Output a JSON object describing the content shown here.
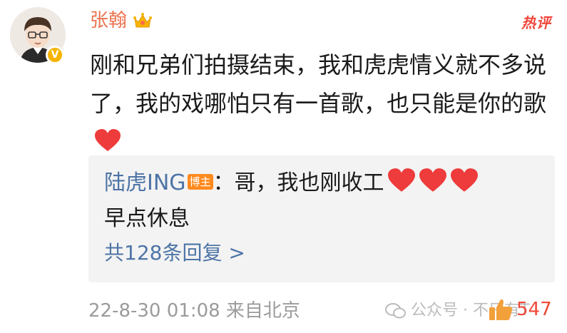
{
  "comment": {
    "username": "张翰",
    "hot_label": "热评",
    "text": "刚和兄弟们拍摄结束，我和虎虎情义就不多说了，我的戏哪怕只有一首歌，也只能是你的歌",
    "timestamp": "22-8-30 01:08 来自北京",
    "like_count": "547"
  },
  "reply": {
    "username": "陆虎ING",
    "badge": "博主",
    "text_part1": "：哥，我也刚收工",
    "text_part2": "早点休息",
    "more_label": "共128条回复 >"
  },
  "watermark": "公众号 · 不只有T"
}
